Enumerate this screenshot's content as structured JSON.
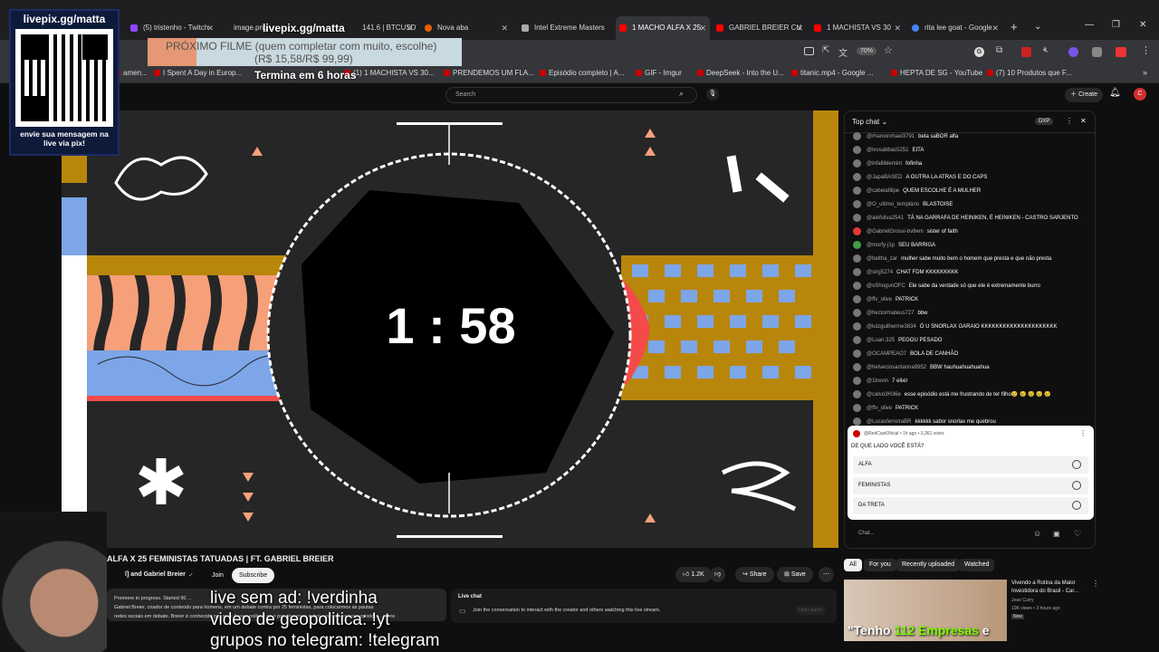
{
  "tabs": [
    {
      "label": "(5) tristenho - Twitch",
      "color": "#9146ff"
    },
    {
      "label": "image.png",
      "color": "#666"
    },
    {
      "label": "141.6 | BTCUSDT",
      "color": "#f0b90b"
    },
    {
      "label": "Nova aba",
      "color": "#e66000"
    },
    {
      "label": "Intel Extreme Masters",
      "color": "#aaa"
    },
    {
      "label": "1 MACHO ALFA X 25",
      "color": "#f00"
    },
    {
      "label": "GABRIEL BREIER CU",
      "color": "#f00"
    },
    {
      "label": "1 MACHISTA VS 30",
      "color": "#f00"
    },
    {
      "label": "rita lee goat - Google",
      "color": "#4285f4"
    }
  ],
  "browser": {
    "zoom": "70%",
    "new_tab": "+"
  },
  "bookmarks": [
    "amen...",
    "I Spent A Day in Europ...",
    "(1) 1 MACHISTA VS 30...",
    "PRENDEMOS UM FLA...",
    "Episódio completo | A...",
    "GIF - Imgur",
    "DeepSeek - Into the U...",
    "titanic.mp4 - Google ...",
    "HEPTA DE SG - YouTube",
    "(7) 10 Produtos que F..."
  ],
  "youtube": {
    "search_placeholder": "Search",
    "create_label": "Create",
    "avatar_letter": "C"
  },
  "overlay": {
    "qr_title": "livepix.gg/matta",
    "qr_caption": "envie sua mensagem na live via pix!",
    "banner_site": "livepix.gg/matta",
    "banner_title": "PRÓXIMO FILME (quem completar com muito, escolhe)",
    "banner_amount": "(R$ 15,58/R$ 99,99)",
    "banner_timer": "Termina em 6 horas"
  },
  "player": {
    "countdown": "1 : 58"
  },
  "video": {
    "title": "ALFA X 25 FEMINISTAS TATUADAS | FT. GABRIEL BREIER",
    "channel": "l] and Gabriel Breier",
    "join": "Join",
    "subscribe": "Subscribe",
    "likes": "1.2K",
    "share": "Share",
    "save": "Save",
    "desc_line1": "Premiere in progress. Started 90 ...",
    "desc_line2": "Gabriel Breier, criador de conteúdo para homens, em um debate contra por 25 feministas, para colocarmos as pautas",
    "desc_line3": "redes sociais em debate. Breier é conhecido por suas frases polêmicas e por discursos sobre, vamos ver esse episódio",
    "desc_more": "...more",
    "livechat_title": "Live chat",
    "livechat_text": "Join the conversation to interact with the creator and others watching this live stream.",
    "open_panel": "Open panel"
  },
  "chat": {
    "title": "Top chat",
    "badge": "DXP",
    "messages": [
      {
        "author": "@rhamonrhael3791",
        "text": "beta saBOR alfa"
      },
      {
        "author": "@ivosabbas5251",
        "text": "EITA"
      },
      {
        "author": "@infalliblemint",
        "text": "fofinha"
      },
      {
        "author": "@JapaBASED",
        "text": "A OUTRA LA ATRAS E DO CAPS"
      },
      {
        "author": "@cabelafilipe",
        "text": "QUEM ESCOLHE É A MULHER"
      },
      {
        "author": "@O_ultimo_templário",
        "text": "BLASTOISE"
      },
      {
        "author": "@alefsilva2541",
        "text": "TÁ NA GARRAFA DE HEINIKEN, É HEINIKEN - CASTRO SARJENTO"
      },
      {
        "author": "@GabrielGrossi-bv8em",
        "text": "sister of faith"
      },
      {
        "author": "@morfy-j1p",
        "text": "SEU BARRIGA"
      },
      {
        "author": "@baltha_zar",
        "text": "mulher sabe muito bem o homem que presta e que não presta"
      },
      {
        "author": "@sirg5274",
        "text": "CHAT FDM KKKKKKKKK"
      },
      {
        "author": "@oShogunOFC",
        "text": "Ele sabe da verdade só que ele é extremamente burro"
      },
      {
        "author": "@ffv_olive",
        "text": "PATRICK"
      },
      {
        "author": "@hectormateus727",
        "text": "bbw"
      },
      {
        "author": "@luizguilherme3834",
        "text": "Ó U SNORLAX GARAIO KKKKKKKKKKKKKKKKKKKKK"
      },
      {
        "author": "@Luan.325",
        "text": "PEGOU PESADO"
      },
      {
        "author": "@OCAMPEAO7",
        "text": "BOLA DE CANHÃO"
      },
      {
        "author": "@helveciosantanna9952",
        "text": "BBW hauhuahuahuahua"
      },
      {
        "author": "@1trevin",
        "text": "7 elixir"
      },
      {
        "author": "@calvo3H36e",
        "text": "esse episódio está me frustrando de ter filho😢 😢 😢 😢 😢"
      },
      {
        "author": "@ffv_olive",
        "text": "PATRICK"
      },
      {
        "author": "@LucasferreiraBR",
        "text": "kkkkkk sabor snorlax me quebrou"
      }
    ],
    "poll_author": "@RedCastOficial • 1h ago • 3,361 votes",
    "poll_question": "DE QUE LADO VOCÊ ESTÁ?",
    "poll_options": [
      "ALFA",
      "FEMINISTAS",
      "DA TRETA"
    ],
    "input_placeholder": "Chat..."
  },
  "related": {
    "chips": [
      "All",
      "For you",
      "Recently uploaded",
      "Watched"
    ],
    "video_title": "Vivendo a Rotina da Maior Investidora do Brasil - Car...",
    "video_channel": "Joao Curry",
    "video_meta": "10K views • 3 hours ago",
    "video_badge": "New",
    "thumb_caption_a": "\"Tenho ",
    "thumb_caption_b": "112 Empresas",
    "thumb_caption_c": " e"
  },
  "stream_subs": [
    "live sem ad: !verdinha",
    "video de geopolitica: !yt",
    "grupos no telegram: !telegram"
  ],
  "colors": {
    "accent": "#ff0000",
    "gold": "#b8860b",
    "blue": "#7ca6e8",
    "salmon": "#f6a07a",
    "red": "#f44a4a"
  }
}
